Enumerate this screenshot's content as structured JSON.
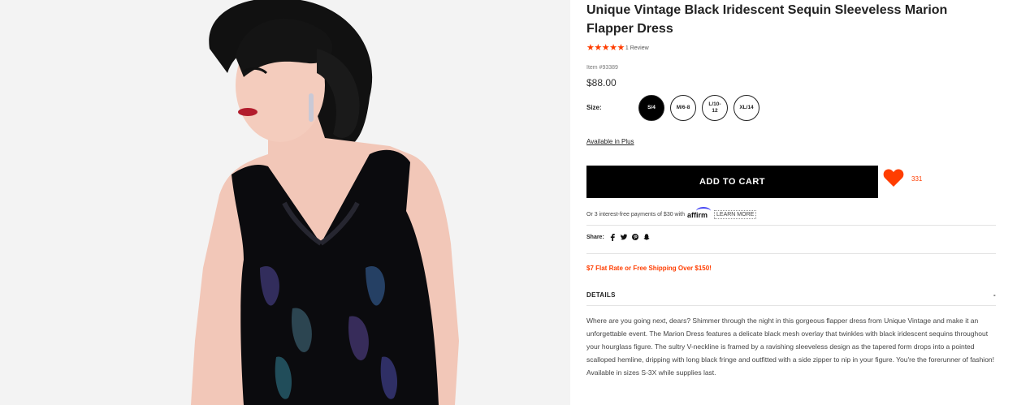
{
  "product": {
    "title": "Unique Vintage Black Iridescent Sequin Sleeveless Marion Flapper Dress",
    "rating_stars": 5,
    "review_text": "1 Review",
    "item_number": "Item #93389",
    "price": "$88.00"
  },
  "sizes": {
    "label": "Size:",
    "options": [
      {
        "label": "S/4",
        "selected": true
      },
      {
        "label": "M/6-8",
        "selected": false
      },
      {
        "label": "L/10-\n12",
        "selected": false
      },
      {
        "label": "XL/14",
        "selected": false
      }
    ]
  },
  "available_plus": "Available in Plus",
  "cart": {
    "add_label": "ADD TO CART",
    "wishlist_count": "331"
  },
  "affirm": {
    "text": "Or 3 interest-free payments of $30 with",
    "logo": "affirm",
    "learn_more": "LEARN MORE"
  },
  "share": {
    "label": "Share:",
    "icons": [
      "facebook-icon",
      "twitter-icon",
      "pinterest-icon",
      "snapchat-icon"
    ]
  },
  "shipping_promo": "$7 Flat Rate or Free Shipping Over $150!",
  "details": {
    "heading": "DETAILS",
    "toggle": "-",
    "description": "Where are you going next, dears? Shimmer through the night in this gorgeous flapper dress from Unique Vintage and make it an unforgettable event. The Marion Dress features a delicate black mesh overlay that twinkles with black iridescent sequins throughout your hourglass figure. The sultry V-neckline is framed by a ravishing sleeveless design as the tapered form drops into a pointed scalloped hemline, dripping with long black fringe and outfitted with a side zipper to nip in your figure. You're the forerunner of fashion!",
    "availability": "Available in sizes S-3X while supplies last."
  },
  "colors": {
    "accent": "#ff3d00",
    "button": "#000000",
    "affirm_arc": "#4a4af4"
  }
}
